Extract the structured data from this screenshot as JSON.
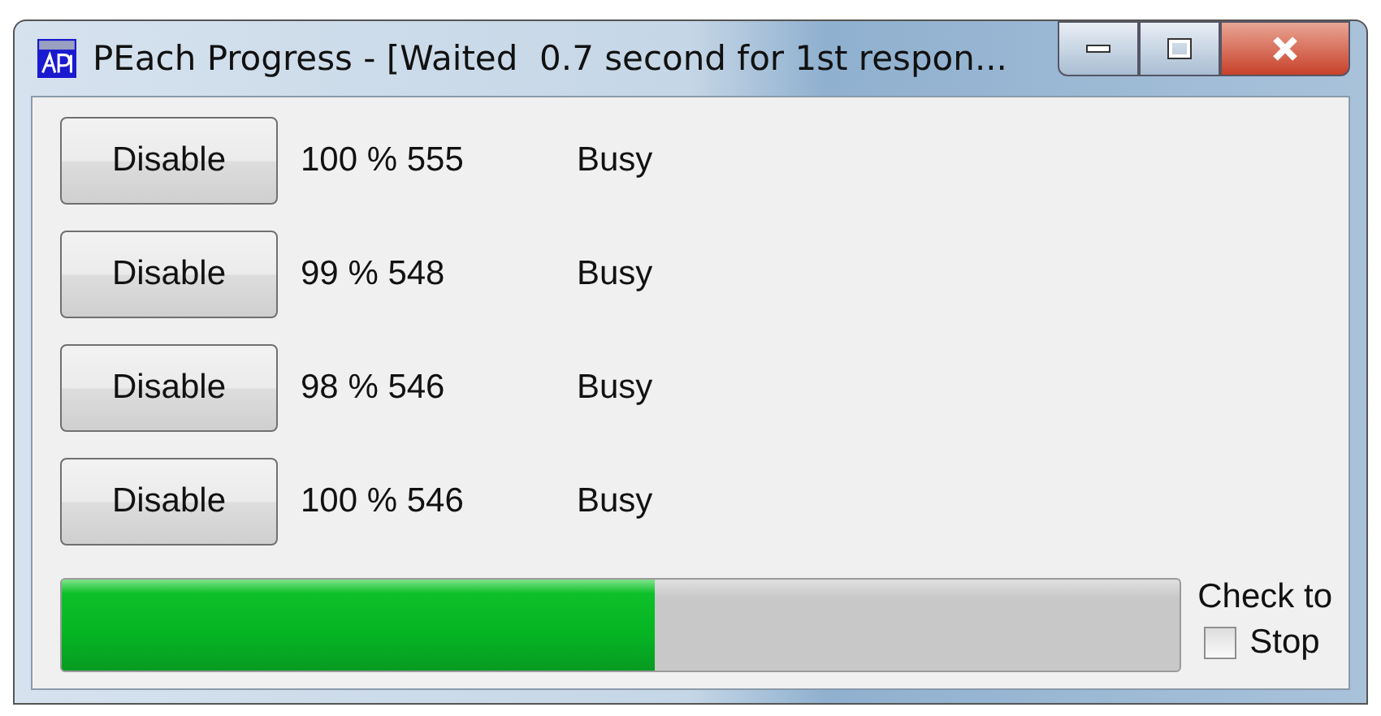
{
  "window": {
    "title": "PEach Progress - [Waited  0.7 second for 1st respon..."
  },
  "rows": [
    {
      "button": "Disable",
      "progress": "100 % 555",
      "status": "Busy"
    },
    {
      "button": "Disable",
      "progress": "99 % 548",
      "status": "Busy"
    },
    {
      "button": "Disable",
      "progress": "98 % 546",
      "status": "Busy"
    },
    {
      "button": "Disable",
      "progress": "100 % 546",
      "status": "Busy"
    }
  ],
  "progress_bar": {
    "level": 0.53
  },
  "stop_checkbox": {
    "caption": "Check to",
    "label": "Stop",
    "checked": false
  }
}
